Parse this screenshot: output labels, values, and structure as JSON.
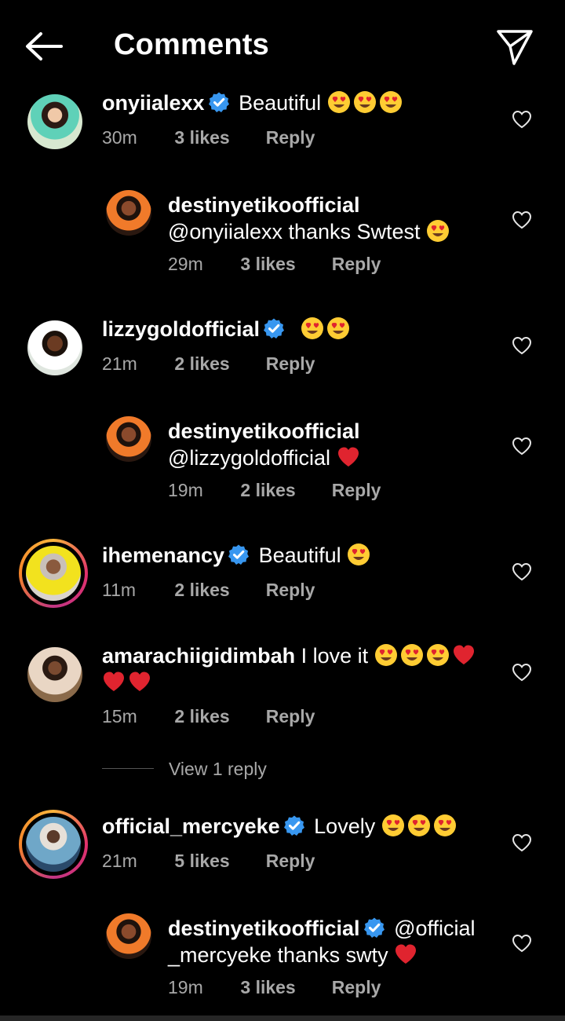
{
  "header": {
    "title": "Comments"
  },
  "comments": [
    {
      "user": "onyiialexx",
      "verified": true,
      "text": "Beautiful",
      "emoji": [
        "heart-eyes",
        "heart-eyes",
        "heart-eyes"
      ],
      "time": "30m",
      "likes": "3 likes",
      "reply": "Reply"
    },
    {
      "user": "destinyetikoofficial",
      "verified": false,
      "text": "@onyiialexx thanks Swtest",
      "emoji": [
        "heart-eyes"
      ],
      "time": "29m",
      "likes": "3 likes",
      "reply": "Reply"
    },
    {
      "user": "lizzygoldofficial",
      "verified": true,
      "text": "",
      "emoji": [
        "heart-eyes",
        "heart-eyes"
      ],
      "time": "21m",
      "likes": "2 likes",
      "reply": "Reply"
    },
    {
      "user": "destinyetikoofficial",
      "verified": false,
      "text": "@lizzygoldofficial",
      "emoji": [
        "red-heart"
      ],
      "time": "19m",
      "likes": "2 likes",
      "reply": "Reply"
    },
    {
      "user": "ihemenancy",
      "verified": true,
      "text": "Beautiful",
      "emoji": [
        "heart-eyes"
      ],
      "time": "11m",
      "likes": "2 likes",
      "reply": "Reply"
    },
    {
      "user": "amarachiigidimbah",
      "verified": false,
      "text": "I love it",
      "emoji": [
        "heart-eyes",
        "heart-eyes",
        "heart-eyes",
        "red-heart",
        "red-heart",
        "red-heart"
      ],
      "time": "15m",
      "likes": "2 likes",
      "reply": "Reply"
    },
    {
      "user": "official_mercyeke",
      "verified": true,
      "text": "Lovely",
      "emoji": [
        "heart-eyes",
        "heart-eyes",
        "heart-eyes"
      ],
      "time": "21m",
      "likes": "5 likes",
      "reply": "Reply"
    },
    {
      "user": "destinyetikoofficial",
      "verified": true,
      "text_line1": "@official",
      "text_line2": "_mercyeke thanks swty",
      "emoji": [
        "red-heart"
      ],
      "time": "19m",
      "likes": "3 likes",
      "reply": "Reply"
    }
  ],
  "view_replies": "View 1 reply",
  "colors": {
    "background": "#000000",
    "verified": "#3897f0",
    "meta": "#a8a8a8",
    "emoji": "#ffcc33",
    "heart_emoji": "#e0242f"
  }
}
